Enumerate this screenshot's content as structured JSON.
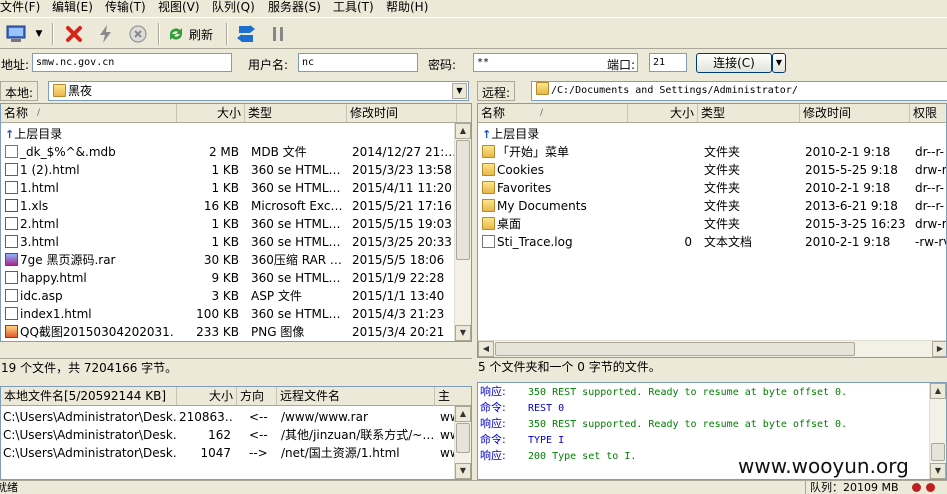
{
  "menu": [
    "文件(F)",
    "编辑(E)",
    "传输(T)",
    "队列(Q)",
    "服务器(S)",
    "工具(T)",
    "帮助(H)"
  ],
  "menu_partial": "视图(V)",
  "toolbar": {
    "refresh": "刷新"
  },
  "conn": {
    "host_label": "地址:",
    "host": "smw.nc.gov.cn",
    "user_label": "用户名:",
    "user": "nc",
    "pass_label": "密码:",
    "pass": "**",
    "port_label": "端口:",
    "port": "21",
    "connect_button": "连接(C)"
  },
  "local": {
    "path_label": "本地:",
    "path": "黑夜",
    "columns": [
      "名称",
      "大小",
      "类型",
      "修改时间"
    ],
    "up_label": "上层目录",
    "files": [
      {
        "name": "_dk_$%^&.mdb",
        "size": "2 MB",
        "type": "MDB 文件",
        "modified": "2014/12/27 21:…",
        "icon": "file"
      },
      {
        "name": "1 (2).html",
        "size": "1 KB",
        "type": "360 se HTML…",
        "modified": "2015/3/23 13:58",
        "icon": "html"
      },
      {
        "name": "1.html",
        "size": "1 KB",
        "type": "360 se HTML…",
        "modified": "2015/4/11 11:20",
        "icon": "html"
      },
      {
        "name": "1.xls",
        "size": "16 KB",
        "type": "Microsoft Exc…",
        "modified": "2015/5/21 17:16",
        "icon": "xls"
      },
      {
        "name": "2.html",
        "size": "1 KB",
        "type": "360 se HTML…",
        "modified": "2015/5/15 19:03",
        "icon": "html"
      },
      {
        "name": "3.html",
        "size": "1 KB",
        "type": "360 se HTML…",
        "modified": "2015/3/25 20:33",
        "icon": "html"
      },
      {
        "name": "7ge 黑页源码.rar",
        "size": "30 KB",
        "type": "360压缩 RAR …",
        "modified": "2015/5/5 18:06",
        "icon": "rar"
      },
      {
        "name": "happy.html",
        "size": "9 KB",
        "type": "360 se HTML…",
        "modified": "2015/1/9 22:28",
        "icon": "html"
      },
      {
        "name": "idc.asp",
        "size": "3 KB",
        "type": "ASP 文件",
        "modified": "2015/1/1 13:40",
        "icon": "asp"
      },
      {
        "name": "index1.html",
        "size": "100 KB",
        "type": "360 se HTML…",
        "modified": "2015/4/3 21:23",
        "icon": "html"
      },
      {
        "name": "QQ截图20150304202031…",
        "size": "233 KB",
        "type": "PNG 图像",
        "modified": "2015/3/4 20:21",
        "icon": "png"
      }
    ],
    "status": "19 个文件，共 7204166 字节。"
  },
  "remote": {
    "path_label": "远程:",
    "path": "/C:/Documents and Settings/Administrator/",
    "columns": [
      "名称",
      "大小",
      "类型",
      "修改时间",
      "权限"
    ],
    "up_label": "上层目录",
    "files": [
      {
        "name": "「开始」菜单",
        "size": "",
        "type": "文件夹",
        "modified": "2010-2-1 9:18",
        "perm": "dr--r-",
        "icon": "folder"
      },
      {
        "name": "Cookies",
        "size": "",
        "type": "文件夹",
        "modified": "2015-5-25 9:18",
        "perm": "drw-rv",
        "icon": "folder"
      },
      {
        "name": "Favorites",
        "size": "",
        "type": "文件夹",
        "modified": "2010-2-1 9:18",
        "perm": "dr--r-",
        "icon": "folder"
      },
      {
        "name": "My Documents",
        "size": "",
        "type": "文件夹",
        "modified": "2013-6-21 9:18",
        "perm": "dr--r-",
        "icon": "folder"
      },
      {
        "name": "桌面",
        "size": "",
        "type": "文件夹",
        "modified": "2015-3-25 16:23",
        "perm": "drw-rv",
        "icon": "folder"
      },
      {
        "name": "Sti_Trace.log",
        "size": "0",
        "type": "文本文档",
        "modified": "2010-2-1 9:18",
        "perm": "-rw-rv",
        "icon": "file"
      }
    ],
    "status": "5 个文件夹和一个 0 字节的文件。"
  },
  "queue": {
    "columns": [
      "本地文件名[5/20592144 KB]",
      "大小",
      "方向",
      "远程文件名",
      "主"
    ],
    "items": [
      {
        "local": "C:\\Users\\Administrator\\Desk…",
        "size": "210863…",
        "dir": "<--",
        "remote": "/www/www.rar",
        "host": "ww"
      },
      {
        "local": "C:\\Users\\Administrator\\Desk…",
        "size": "162",
        "dir": "<--",
        "remote": "/其他/jinzuan/联系方式/~…",
        "host": "ww"
      },
      {
        "local": "C:\\Users\\Administrator\\Desk…",
        "size": "1047",
        "dir": "-->",
        "remote": "/net/国土资源/1.html",
        "host": "ww"
      }
    ]
  },
  "log": [
    {
      "kind": "响应:",
      "text": "350 REST supported. Ready to resume at byte offset 0.",
      "color": "#008000"
    },
    {
      "kind": "命令:",
      "text": "REST 0",
      "color": "#0000cc"
    },
    {
      "kind": "响应:",
      "text": "350 REST supported. Ready to resume at byte offset 0.",
      "color": "#008000"
    },
    {
      "kind": "命令:",
      "text": "TYPE I",
      "color": "#0000cc"
    },
    {
      "kind": "响应:",
      "text": "200 Type set to I.",
      "color": "#008000"
    }
  ],
  "statusbar": {
    "ready": "就绪",
    "queue": "队列：20109 MB"
  },
  "watermark": "www.wooyun.org"
}
